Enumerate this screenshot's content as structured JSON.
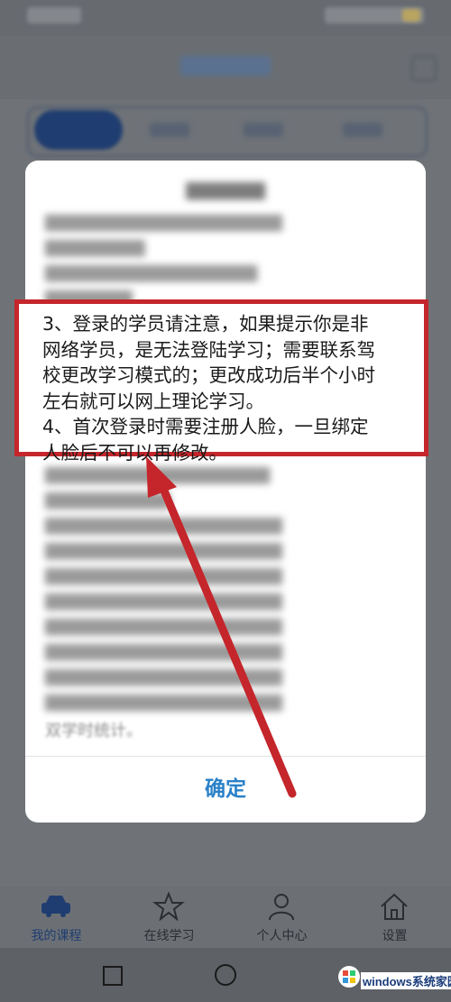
{
  "dialog": {
    "highlighted_lines": [
      "3、登录的学员请注意，如果提示你是非",
      "网络学员，是无法登陆学习；需要联系驾",
      "校更改学习模式的；更改成功后半个小时",
      "左右就可以网上理论学习。",
      "4、首次登录时需要注册人脸，一旦绑定",
      "人脸后不可以再修改。"
    ],
    "bottom_visible_line": "双学时统计。",
    "confirm_label": "确定"
  },
  "bottom_nav": {
    "items": [
      {
        "label": "我的课程",
        "icon": "car-icon",
        "active": true
      },
      {
        "label": "在线学习",
        "icon": "star-icon",
        "active": false
      },
      {
        "label": "个人中心",
        "icon": "person-icon",
        "active": false
      },
      {
        "label": "设置",
        "icon": "home-icon",
        "active": false
      }
    ]
  },
  "watermark": {
    "text": "windows系统家园"
  },
  "colors": {
    "highlight_red": "#c4262b",
    "confirm_blue": "#2a81c8",
    "active_nav": "#1f3d70"
  }
}
